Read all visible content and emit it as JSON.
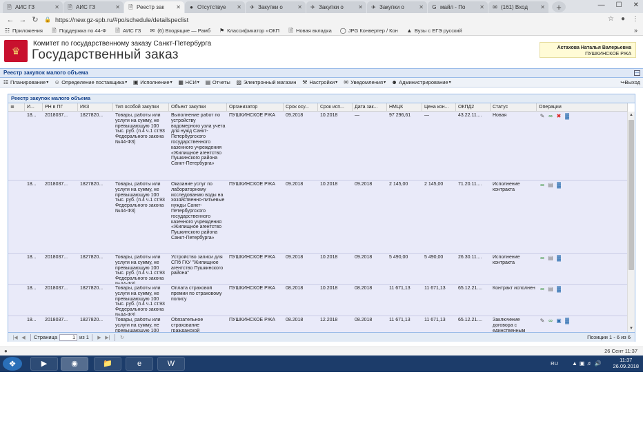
{
  "browser": {
    "tabs": [
      {
        "label": "АИС ГЗ",
        "icon": "doc-icon",
        "active": false
      },
      {
        "label": "АИС ГЗ",
        "icon": "doc-icon",
        "active": false
      },
      {
        "label": "Реестр зак",
        "icon": "doc-icon",
        "active": true
      },
      {
        "label": "Отсутствуе",
        "icon": "globe-icon",
        "active": false
      },
      {
        "label": "Закупки о",
        "icon": "cart-icon",
        "active": false
      },
      {
        "label": "Закупки о",
        "icon": "cart-icon",
        "active": false
      },
      {
        "label": "Закупки о",
        "icon": "cart-icon",
        "active": false
      },
      {
        "label": "майл - По",
        "icon": "google-icon",
        "active": false
      },
      {
        "label": "(161) Вход",
        "icon": "mail-icon",
        "active": false
      }
    ],
    "url": "https://new.gz-spb.ru/#po/schedule/detailspeclist",
    "bookmarks": [
      {
        "label": "Приложения",
        "icon": "apps-icon"
      },
      {
        "label": "Поддержка по 44-Ф",
        "icon": "doc-icon"
      },
      {
        "label": "АИС ГЗ",
        "icon": "doc-icon"
      },
      {
        "label": "(6) Входящие — Рамб",
        "icon": "mail-icon"
      },
      {
        "label": "Классификатор «ОКП",
        "icon": "flag-icon"
      },
      {
        "label": "Новая вкладка",
        "icon": "doc-icon"
      },
      {
        "label": "JPG Конвертер / Кон",
        "icon": "circle-icon"
      },
      {
        "label": "Вузы с ЕГЭ русский",
        "icon": "cap-icon"
      }
    ]
  },
  "header": {
    "committee": "Комитет по государственному заказу Санкт-Петербурга",
    "title": "Государственный заказ",
    "user_name": "Астахова Наталья Валерьевна",
    "user_org": "ПУШКИНСКОЕ РЖА"
  },
  "section_title": "Реестр закупок малого объема",
  "menu": [
    {
      "label": "Планирование",
      "icon": "grid-icon",
      "dropdown": true
    },
    {
      "label": "Определение поставщика",
      "icon": "people-icon",
      "dropdown": true
    },
    {
      "label": "Исполнение",
      "icon": "truck-icon",
      "dropdown": true
    },
    {
      "label": "НСИ",
      "icon": "table-icon",
      "dropdown": true
    },
    {
      "label": "Отчеты",
      "icon": "report-icon",
      "dropdown": false
    },
    {
      "label": "Электронный магазин",
      "icon": "shop-icon",
      "dropdown": false
    },
    {
      "label": "Настройки",
      "icon": "wrench-icon",
      "dropdown": true
    },
    {
      "label": "Уведомления",
      "icon": "envelope-icon",
      "dropdown": true
    },
    {
      "label": "Администрирование",
      "icon": "user-icon",
      "dropdown": true
    }
  ],
  "exit_label": "Выход",
  "grid": {
    "title": "Реестр закупок малого объема",
    "columns": [
      "",
      "И...",
      "РН в ПГ",
      "ИКЗ",
      "Тип особой закупки",
      "Объект закупки",
      "Организатор",
      "Срок осу...",
      "Срок исп...",
      "Дата зак...",
      "НМЦК",
      "Цена кон...",
      "ОКПД2",
      "Статус",
      "Операции"
    ],
    "rows": [
      {
        "id": "18...",
        "rn": "2018037...",
        "ikz": "1827820...",
        "type": "Товары, работы или услуги на сумму, не превышающую 100 тыс. руб. (п.4 ч.1 ст.93 Федерального закона №44-ФЗ)",
        "object": "Выполнение работ по устройству водомерного узла учета для нужд Санкт-Петербургского государственного казенного учреждения «Жилищное агентство Пушкинского района Санкт-Петербурга»",
        "org": "ПУШКИНСКОЕ РЖА",
        "srok_osu": "09.2018",
        "srok_isp": "10.2018",
        "date": "—",
        "nmck": "97 296,61",
        "price": "—",
        "okpd": "43.22.11....",
        "status": "Новая",
        "ops": [
          "edit-icon",
          "link-icon",
          "delete-icon",
          "chart-icon"
        ]
      },
      {
        "id": "18...",
        "rn": "2018037...",
        "ikz": "1827820...",
        "type": "Товары, работы или услуги на сумму, не превышающую 100 тыс. руб. (п.4 ч.1 ст.93 Федерального закона №44-ФЗ)",
        "object": "Оказание услуг по лабораторному исследованию воды на хозяйственно-питьевые нужды Санкт-Петербургского государственного казенного учреждения «Жилищное агентство Пушкинского района Санкт-Петербурга»",
        "org": "ПУШКИНСКОЕ РЖА",
        "srok_osu": "09.2018",
        "srok_isp": "10.2018",
        "date": "09.2018",
        "nmck": "2 145,00",
        "price": "2 145,00",
        "okpd": "71.20.11....",
        "status": "Исполнение контракта",
        "ops": [
          "link-icon",
          "document-icon",
          "chart-icon"
        ]
      },
      {
        "id": "18...",
        "rn": "2018037...",
        "ikz": "1827820...",
        "type": "Товары, работы или услуги на сумму, не превышающую 100 тыс. руб. (п.4 ч.1 ст.93 Федерального закона №44-ФЗ)",
        "object": "Устройство записи для СПб ГКУ \"Жилищное агентство Пушкинского района\"",
        "org": "ПУШКИНСКОЕ РЖА",
        "srok_osu": "09.2018",
        "srok_isp": "10.2018",
        "date": "09.2018",
        "nmck": "5 490,00",
        "price": "5 490,00",
        "okpd": "26.30.11....",
        "status": "Исполнение контракта",
        "ops": [
          "link-icon",
          "document-icon",
          "chart-icon"
        ]
      },
      {
        "id": "18...",
        "rn": "2018037...",
        "ikz": "1827820...",
        "type": "Товары, работы или услуги на сумму, не превышающую 100 тыс. руб. (п.4 ч.1 ст.93 Федерального закона №44-ФЗ)",
        "object": "Оплата страховой премии по страховому полису",
        "org": "ПУШКИНСКОЕ РЖА",
        "srok_osu": "08.2018",
        "srok_isp": "10.2018",
        "date": "08.2018",
        "nmck": "11 671,13",
        "price": "11 671,13",
        "okpd": "65.12.21....",
        "status": "Контракт исполнен",
        "ops": [
          "link-icon",
          "document-icon",
          "chart-icon"
        ]
      },
      {
        "id": "18...",
        "rn": "2018037...",
        "ikz": "1827820...",
        "type": "Товары, работы или услуги на сумму, не превышающую 100",
        "object": "Обязательное страхование гражданской",
        "org": "ПУШКИНСКОЕ РЖА",
        "srok_osu": "08.2018",
        "srok_isp": "12.2018",
        "date": "08.2018",
        "nmck": "11 671,13",
        "price": "11 671,13",
        "okpd": "65.12.21....",
        "status": "Заключение договора с единственным",
        "ops": [
          "edit-icon",
          "link-icon",
          "save-icon",
          "chart-icon"
        ]
      }
    ]
  },
  "pager": {
    "page_label": "Страница",
    "page_value": "1",
    "of_label": "из 1",
    "info": "Позиции 1 - 6 из 6"
  },
  "statusbar": {
    "date": "26 Сент 11:37"
  },
  "taskbar": {
    "lang": "RU",
    "time": "11:37",
    "date": "26.09.2018"
  }
}
